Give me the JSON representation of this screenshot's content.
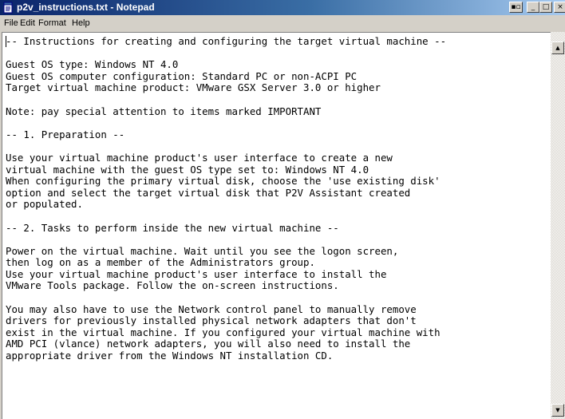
{
  "window": {
    "title": "p2v_instructions.txt - Notepad",
    "title_bar_buttons": {
      "extra": "▪▫",
      "minimize": "_",
      "maximize": "□",
      "close": "×"
    }
  },
  "menu": {
    "file": "File",
    "edit": "Edit",
    "format": "Format",
    "help": "Help"
  },
  "document": {
    "text": "-- Instructions for creating and configuring the target virtual machine --\n\nGuest OS type: Windows NT 4.0\nGuest OS computer configuration: Standard PC or non-ACPI PC\nTarget virtual machine product: VMware GSX Server 3.0 or higher\n\nNote: pay special attention to items marked IMPORTANT\n\n-- 1. Preparation --\n\nUse your virtual machine product's user interface to create a new\nvirtual machine with the guest OS type set to: Windows NT 4.0\nWhen configuring the primary virtual disk, choose the 'use existing disk'\noption and select the target virtual disk that P2V Assistant created\nor populated.\n\n-- 2. Tasks to perform inside the new virtual machine --\n\nPower on the virtual machine. Wait until you see the logon screen,\nthen log on as a member of the Administrators group.\nUse your virtual machine product's user interface to install the\nVMware Tools package. Follow the on-screen instructions.\n\nYou may also have to use the Network control panel to manually remove\ndrivers for previously installed physical network adapters that don't\nexist in the virtual machine. If you configured your virtual machine with\nAMD PCI (vlance) network adapters, you will also need to install the\nappropriate driver from the Windows NT installation CD."
  },
  "scrollbar": {
    "up_arrow": "▲",
    "down_arrow": "▼"
  },
  "colors": {
    "title_bar_start": "#0a246a",
    "title_bar_end": "#a6caf0",
    "window_face": "#d4d0c8",
    "edit_background": "#ffffff",
    "text": "#000000"
  },
  "icons": {
    "app": "notepad-icon"
  }
}
